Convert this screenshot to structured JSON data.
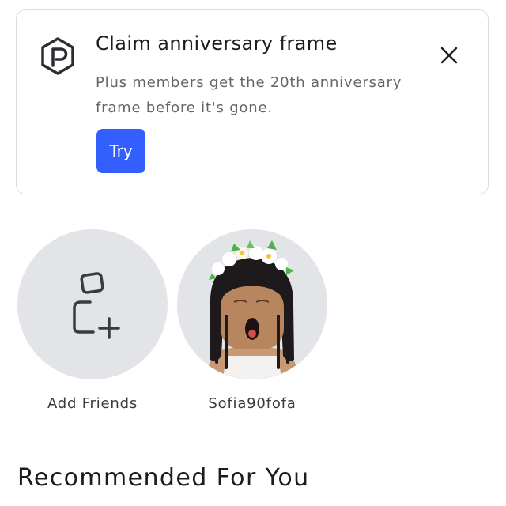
{
  "promo": {
    "title": "Claim anniversary frame",
    "body": "Plus members get the 20th anniversary frame before it's gone.",
    "try_label": "Try",
    "logo_icon": "plus-logo-icon",
    "close_icon": "close-icon",
    "accent_color": "#335fff"
  },
  "friends": [
    {
      "label": "Add Friends",
      "icon": "add-friend-icon"
    },
    {
      "label": "Sofia90fofa",
      "icon": "avatar"
    }
  ],
  "recommended": {
    "title": "Recommended For You"
  }
}
